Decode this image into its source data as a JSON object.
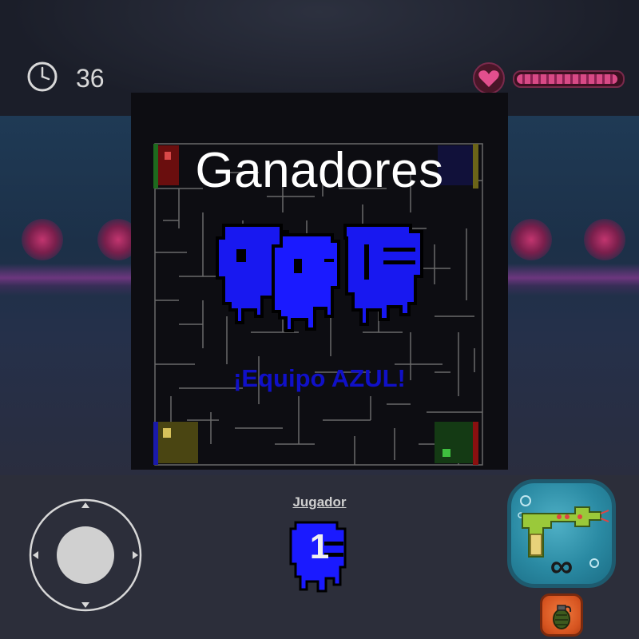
{
  "hud": {
    "timer": "36",
    "health_fraction": 0.97
  },
  "results": {
    "title": "Ganadores",
    "team_label": "¡Equipo AZUL!",
    "team_color": "#1010c8"
  },
  "player": {
    "label": "Jugador",
    "number": "1"
  },
  "weapon": {
    "ammo": "∞",
    "icon": "ray-gun-icon"
  },
  "secondary": {
    "icon": "grenade-icon"
  },
  "colors": {
    "team_blue": "#1a1aff",
    "team_green": "#1e6a1e",
    "team_yellow": "#6b6418",
    "team_red": "#8a1010",
    "health": "#d84a86"
  }
}
